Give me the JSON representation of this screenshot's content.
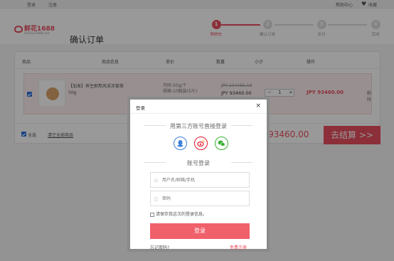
{
  "topbar": {
    "login": "登录",
    "register": "注册",
    "help": "帮助中心",
    "favorites": "收藏"
  },
  "header": {
    "logo_name": "鲜花1688",
    "logo_sub": "xianhua1688.com",
    "page_title": "确认订单"
  },
  "steps": [
    {
      "num": "1",
      "label": "购物车",
      "state": "active"
    },
    {
      "num": "2",
      "label": "确认订单",
      "state": "inactive"
    },
    {
      "num": "3",
      "label": "支付",
      "state": "inactive"
    },
    {
      "num": "4",
      "label": "完成",
      "state": "inactive"
    }
  ],
  "table": {
    "headers": [
      "商品",
      "商品信息",
      "单价",
      "数量",
      "小计",
      "操作"
    ],
    "row": {
      "name": "【加发】养生耐熬风采凉菊茶",
      "name2": "50g",
      "spec1": "尺码:50g/个",
      "spec2": "规格:10瓶装(5斤)",
      "old_price": "JPY 104485.19",
      "price": "JPY 93460.00",
      "qty": "1",
      "minus": "−",
      "plus": "+",
      "subtotal": "JPY 93460.00",
      "delete": "删除"
    }
  },
  "footer": {
    "select_all": "全选",
    "clear": "清空全部商品",
    "total": "Y 93460.00",
    "checkout": "去结算 >>"
  },
  "modal": {
    "title": "登录",
    "close": "×",
    "third_party": "用第三方账号直接登录",
    "account": "账号登录",
    "username_placeholder": "用户名/邮箱/手机",
    "password_placeholder": "密码",
    "remember": "请保存我这次的登录信息。",
    "login_button": "登录",
    "forgot": "忘记密码?",
    "register": "免费注册"
  },
  "colors": {
    "accent": "#e94f5e",
    "qq": "#3b7fd9",
    "weibo": "#e6162d",
    "wechat": "#3cb034"
  }
}
